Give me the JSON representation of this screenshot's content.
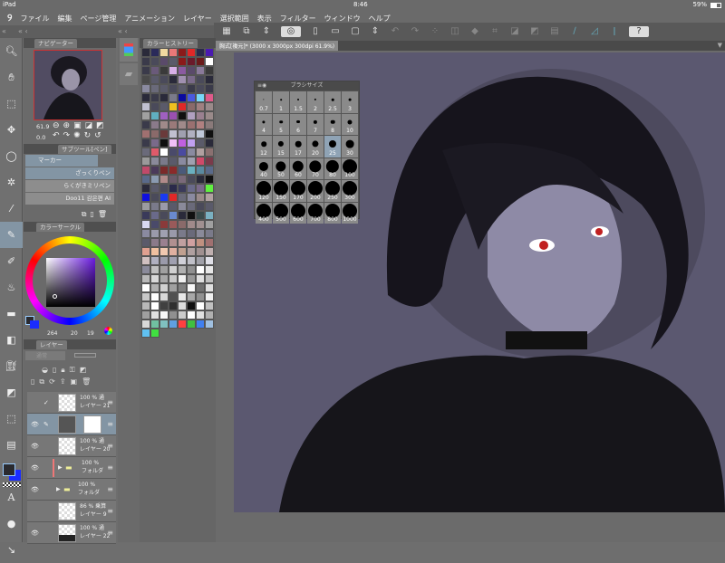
{
  "status": {
    "device": "iPad",
    "time": "8:46",
    "battery": "59%"
  },
  "menu": [
    "ファイル",
    "編集",
    "ページ管理",
    "アニメーション",
    "レイヤー",
    "選択範囲",
    "表示",
    "フィルター",
    "ウィンドウ",
    "ヘルプ"
  ],
  "document_tab": "胸式[複元]* (3000 x 3000px 300dpi 61.9%)",
  "navigator": {
    "title": "ナビゲーター",
    "zoom": "61.9",
    "rotation": "0.0"
  },
  "subtool": {
    "title": "サブツール[ペン]",
    "group": "マーカー",
    "brushes": [
      "ざっくりペン",
      "らくがきミリペン",
      "Doo11 감은편 AI"
    ]
  },
  "color_circle": {
    "title": "カラーサークル",
    "h": "264",
    "s": "20",
    "v": "19",
    "main_color": "#2a2a2e",
    "sub_color": "#1a2cff"
  },
  "layers": {
    "title": "レイヤー",
    "blend": "通常",
    "rows": [
      {
        "pct": "100 % 通",
        "name": "レイヤー 21",
        "visible": false
      },
      {
        "pct": "",
        "name": "",
        "visible": true,
        "selected": true
      },
      {
        "pct": "100 % 通",
        "name": "レイヤー 20",
        "visible": true
      },
      {
        "pct": "100 %",
        "name": "フォルダ",
        "visible": true,
        "folder": true
      },
      {
        "pct": "100 %",
        "name": "フォルダ",
        "visible": true,
        "folder": true
      },
      {
        "pct": "86 % 乗算",
        "name": "レイヤー 9",
        "visible": false
      },
      {
        "pct": "100 % 通",
        "name": "レイヤー 22",
        "visible": true
      }
    ]
  },
  "color_history": {
    "title": "カラーヒストリー",
    "colors": [
      "#2a2a3a",
      "#2a2a5a",
      "#f0d8a0",
      "#e87878",
      "#8a1a1a",
      "#e02828",
      "#2a2a4a",
      "#4a1ab0",
      "#3a3a4a",
      "#4a4a5a",
      "#5a4a6a",
      "#5a5a6a",
      "#8a1a1a",
      "#6a1a2a",
      "#6a1a1a",
      "#ffffff",
      "#3a3a4a",
      "#6a5a7a",
      "#3a3a3a",
      "#d8b0e8",
      "#8a5aa0",
      "#5a4a6a",
      "#8a7a9a",
      "#3a3a3a",
      "#4a4a4a",
      "#5a5a6a",
      "#4a4a5a",
      "#2a2a3a",
      "#a090b0",
      "#7a6a8a",
      "#4a4a5a",
      "#2a2a3a",
      "#8a8aa0",
      "#6a6a7a",
      "#5a5a6a",
      "#4a4a5a",
      "#5a5a6a",
      "#3a3a4a",
      "#4a4a5a",
      "#3a3a4a",
      "#2a2a3a",
      "#3a3a4a",
      "#2a2a3a",
      "#7a7a8a",
      "#0a0aa0",
      "#4a5ae0",
      "#78d8f8",
      "#e05a8a",
      "#c0c0d0",
      "#4a4a5a",
      "#5a5a6a",
      "#f0c020",
      "#e02828",
      "#8a6a6a",
      "#a08080",
      "#9a8a8a",
      "#a0a0a0",
      "#60b0c0",
      "#a060c0",
      "#9a50b0",
      "#101010",
      "#b0a0c0",
      "#9a8090",
      "#9a8a8a",
      "#3a3a4a",
      "#8a7a8a",
      "#a08a8a",
      "#9a7a7a",
      "#a08a8a",
      "#9a7070",
      "#b08080",
      "#8a7a7a",
      "#a07070",
      "#8a6a6a",
      "#6a3a3a",
      "#c0c0d0",
      "#a0a0b0",
      "#b0b0c0",
      "#c0c8d8",
      "#101010",
      "#3a3a4a",
      "#7a6a8a",
      "#101010",
      "#f0c0f8",
      "#c060e0",
      "#c0a0f0",
      "#5a5a6a",
      "#2a2a3a",
      "#6a6a7a",
      "#e05a6a",
      "#ffffff",
      "#4a4a6a",
      "#4a4aa0",
      "#8a8aa0",
      "#b0a0a0",
      "#8a7070",
      "#9a9a9a",
      "#8a8a9a",
      "#7a7a8a",
      "#5a5a6a",
      "#8a8aa0",
      "#a0a0b0",
      "#d04a6a",
      "#7a3a4a",
      "#c04a6a",
      "#4a3a5a",
      "#7a2a2a",
      "#8a2a2a",
      "#4a5a7a",
      "#6ab0c0",
      "#5a8aa0",
      "#5a6a8a",
      "#5a6a8a",
      "#8a9ab0",
      "#b08a8a",
      "#6a5a6a",
      "#7a6a7a",
      "#4a4a5a",
      "#2a2a3a",
      "#101010",
      "#2a2a3a",
      "#5a5a6a",
      "#4a4a5a",
      "#2a2a4a",
      "#3a3a5a",
      "#6a6a8a",
      "#7a6a8a",
      "#60f040",
      "#1010e0",
      "#4a4a5a",
      "#1a3af0",
      "#e02828",
      "#6a6a7a",
      "#8a8aa0",
      "#9a8a8a",
      "#b0a0a0",
      "#9a9aa0",
      "#7a7a8a",
      "#9a9aaa",
      "#5a5a6a",
      "#8a8a9a",
      "#6a6a7a",
      "#4a4a5a",
      "#5a5a6a",
      "#3a3a5a",
      "#6a6a8a",
      "#4a4a5a",
      "#6a8ad0",
      "#2a2a3a",
      "#101010",
      "#3a4a4a",
      "#7ab0c0",
      "#d8d8f0",
      "#4a4a6a",
      "#8a3a3a",
      "#9a5a5a",
      "#8a6a6a",
      "#a08a8a",
      "#a09090",
      "#a0a0a0",
      "#8a8aa0",
      "#9a9aaa",
      "#a0a0b0",
      "#9a9aaa",
      "#7a7a8a",
      "#6a6a7a",
      "#8a8a9a",
      "#7a7a8a",
      "#5a5a6a",
      "#8a7a8a",
      "#9a8090",
      "#b09090",
      "#c0a0a0",
      "#d0a0a0",
      "#c09080",
      "#a07070",
      "#e0a090",
      "#f0c0a0",
      "#f0c8b0",
      "#e0b0a0",
      "#c0a090",
      "#b0a0a0",
      "#a09090",
      "#c0b0b0",
      "#d0c0c0",
      "#b0b0c0",
      "#9a9aaa",
      "#a0a0b0",
      "#d0d0d8",
      "#c0c0c8",
      "#a0a0a8",
      "#e0e0e8",
      "#8a8a9a",
      "#c0c0c0",
      "#a0a0a0",
      "#d0d0d0",
      "#b0b0b0",
      "#909090",
      "#ffffff",
      "#e8e8e8",
      "#b8b8b8",
      "#d8d8d8",
      "#a8a8a8",
      "#c8c8c8",
      "#f0f0f0",
      "#989898",
      "#e0e0e0",
      "#c0c0c0",
      "#ffffff",
      "#b0b0b0",
      "#d0d0d0",
      "#a0a0a0",
      "#808080",
      "#f8f8f8",
      "#707070",
      "#e0e0e0",
      "#c8c8c8",
      "#ffffff",
      "#d8d8d8",
      "#505050",
      "#e8e8e8",
      "#a8a8a8",
      "#909090",
      "#f0f0f0",
      "#b8b8b8",
      "#ffffff",
      "#404040",
      "#303030",
      "#dddddd",
      "#101010",
      "#ffffff",
      "#c0c0c0",
      "#a0a0a0",
      "#e0e0e0",
      "#f8f8f8",
      "#909090",
      "#cccccc",
      "#ffffff",
      "#e0e0e0",
      "#b0b0b0",
      "#d8d8d8",
      "#70c0a0",
      "#80c0c0",
      "#60a0e0",
      "#ff4040",
      "#40c040",
      "#4080f0",
      "#a0c0e0",
      "#60c0f0",
      "#40e040"
    ]
  },
  "brush_size": {
    "title": "ブラシサイズ",
    "sizes": [
      "0.7",
      "1",
      "1.5",
      "2",
      "2.5",
      "3",
      "4",
      "5",
      "6",
      "7",
      "8",
      "10",
      "12",
      "15",
      "17",
      "20",
      "25",
      "30",
      "40",
      "50",
      "60",
      "70",
      "80",
      "100",
      "120",
      "150",
      "170",
      "200",
      "250",
      "300",
      "400",
      "500",
      "600",
      "700",
      "800",
      "1000"
    ],
    "selected": "25"
  }
}
